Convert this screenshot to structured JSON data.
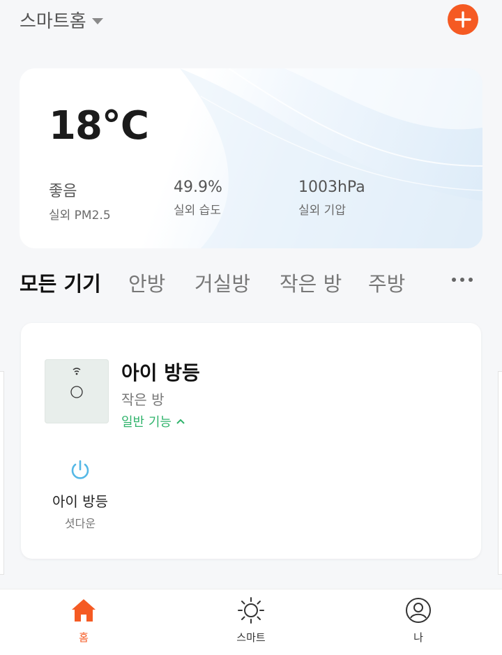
{
  "header": {
    "title": "스마트홈"
  },
  "weather": {
    "temperature": "18°C",
    "stats": [
      {
        "value": "좋음",
        "label": "실외 PM2.5"
      },
      {
        "value": "49.9%",
        "label": "실외 습도"
      },
      {
        "value": "1003hPa",
        "label": "실외 기압"
      }
    ]
  },
  "tabs": [
    {
      "label": "모든 기기",
      "active": true
    },
    {
      "label": "안방"
    },
    {
      "label": "거실방"
    },
    {
      "label": "작은 방"
    },
    {
      "label": "주방"
    }
  ],
  "device": {
    "name": "아이 방등",
    "room": "작은 방",
    "function_label": "일반 기능",
    "switch": {
      "name": "아이 방등",
      "state": "셧다운"
    }
  },
  "nav": [
    {
      "label": "홈",
      "icon": "home-icon",
      "active": true
    },
    {
      "label": "스마트",
      "icon": "sun-icon"
    },
    {
      "label": "나",
      "icon": "user-icon"
    }
  ],
  "colors": {
    "accent": "#f55a23",
    "function_green": "#2fb36b",
    "power_blue": "#55b8e6"
  }
}
